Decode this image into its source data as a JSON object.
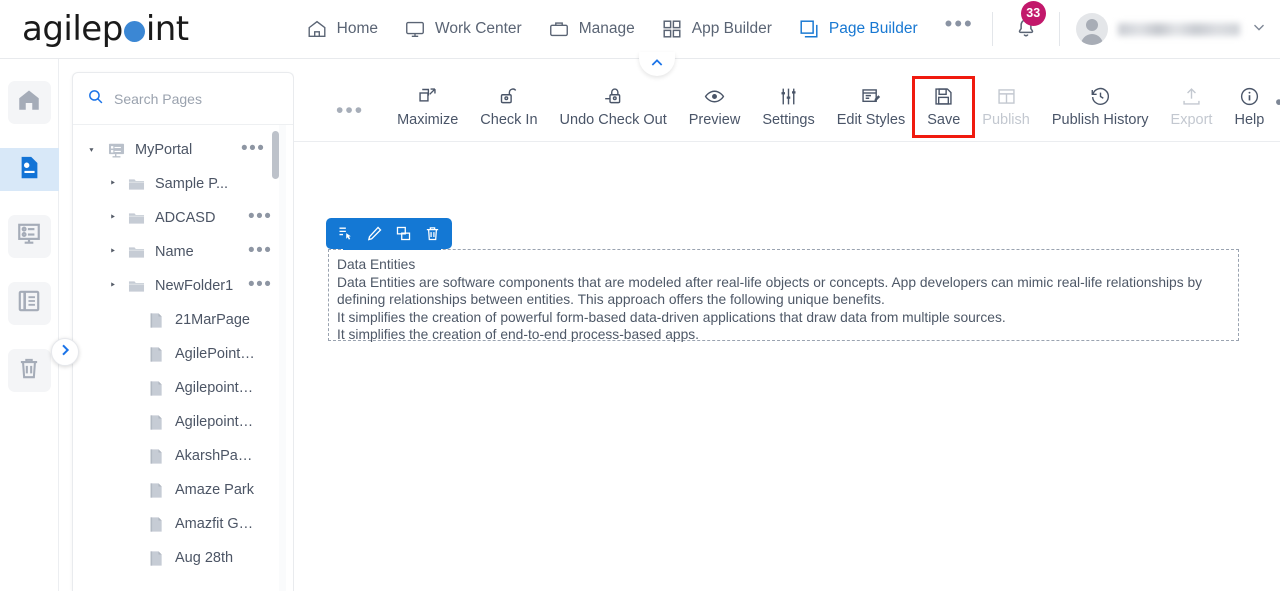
{
  "app": {
    "logo_text_before": "agilep",
    "logo_dot": "o",
    "logo_text_after": "int",
    "brand_blue": "#3b87d4"
  },
  "topnav": {
    "items": [
      {
        "label": "Home",
        "icon": "home-icon",
        "active": false
      },
      {
        "label": "Work Center",
        "icon": "monitor-icon",
        "active": false
      },
      {
        "label": "Manage",
        "icon": "briefcase-icon",
        "active": false
      },
      {
        "label": "App Builder",
        "icon": "grid-icon",
        "active": false
      },
      {
        "label": "Page Builder",
        "icon": "pages-icon",
        "active": true
      }
    ],
    "overflow_label": "•••",
    "notifications": {
      "icon": "bell-icon",
      "count": "33",
      "badge_color": "#c2186b"
    },
    "user": {
      "name_redacted": "",
      "chevron": "chevron-down-icon"
    }
  },
  "rail": {
    "items": [
      {
        "name": "home",
        "icon": "home-icon",
        "active": false
      },
      {
        "name": "pages",
        "icon": "page-document-icon",
        "active": true
      },
      {
        "name": "forms",
        "icon": "form-layout-icon",
        "active": false
      },
      {
        "name": "lists",
        "icon": "list-icon",
        "active": false
      },
      {
        "name": "recycle-bin",
        "icon": "trash-icon",
        "active": false
      }
    ],
    "expand_button": "chevron-right-icon"
  },
  "tree_panel": {
    "search": {
      "placeholder": "Search Pages",
      "value": "",
      "icon": "search-icon"
    },
    "nodes": [
      {
        "label": "MyPortal",
        "icon": "portal-monitor-icon",
        "indent": 0,
        "toggle": "expanded",
        "menu": true,
        "type": "portal"
      },
      {
        "label": "Sample P...",
        "icon": "folder-icon",
        "indent": 1,
        "toggle": "collapsed",
        "menu": false,
        "type": "folder"
      },
      {
        "label": "ADCASD",
        "icon": "folder-icon",
        "indent": 1,
        "toggle": "collapsed",
        "menu": true,
        "type": "folder"
      },
      {
        "label": "Name",
        "icon": "folder-icon",
        "indent": 1,
        "toggle": "collapsed",
        "menu": true,
        "type": "folder"
      },
      {
        "label": "NewFolder1",
        "icon": "folder-icon",
        "indent": 1,
        "toggle": "collapsed",
        "menu": true,
        "type": "folder"
      },
      {
        "label": "21MarPage",
        "icon": "page-icon",
        "indent": 2,
        "toggle": "none",
        "menu": false,
        "type": "page"
      },
      {
        "label": "AgilePoint…",
        "icon": "page-icon",
        "indent": 2,
        "toggle": "none",
        "menu": false,
        "type": "page"
      },
      {
        "label": "Agilepoint…",
        "icon": "page-icon",
        "indent": 2,
        "toggle": "none",
        "menu": false,
        "type": "page"
      },
      {
        "label": "Agilepoint…",
        "icon": "page-icon",
        "indent": 2,
        "toggle": "none",
        "menu": false,
        "type": "page"
      },
      {
        "label": "AkarshPa…",
        "icon": "page-icon",
        "indent": 2,
        "toggle": "none",
        "menu": false,
        "type": "page"
      },
      {
        "label": "Amaze Park",
        "icon": "page-icon",
        "indent": 2,
        "toggle": "none",
        "menu": false,
        "type": "page"
      },
      {
        "label": "Amazfit G…",
        "icon": "page-icon",
        "indent": 2,
        "toggle": "none",
        "menu": false,
        "type": "page"
      },
      {
        "label": "Aug 28th",
        "icon": "page-icon",
        "indent": 2,
        "toggle": "none",
        "menu": false,
        "type": "page"
      }
    ]
  },
  "toolbar": {
    "collapse_chevron": "chevron-up-icon",
    "overflow_left": "•••",
    "items": [
      {
        "label": "Maximize",
        "icon": "maximize-icon",
        "disabled": false,
        "highlighted": false
      },
      {
        "label": "Check In",
        "icon": "unlock-icon",
        "disabled": false,
        "highlighted": false
      },
      {
        "label": "Undo Check Out",
        "icon": "lock-undo-icon",
        "disabled": false,
        "highlighted": false
      },
      {
        "label": "Preview",
        "icon": "eye-icon",
        "disabled": false,
        "highlighted": false
      },
      {
        "label": "Settings",
        "icon": "sliders-icon",
        "disabled": false,
        "highlighted": false
      },
      {
        "label": "Edit Styles",
        "icon": "edit-styles-icon",
        "disabled": false,
        "highlighted": false
      },
      {
        "label": "Save",
        "icon": "save-floppy-icon",
        "disabled": false,
        "highlighted": true
      },
      {
        "label": "Publish",
        "icon": "publish-icon",
        "disabled": true,
        "highlighted": false
      },
      {
        "label": "Publish History",
        "icon": "history-clock-icon",
        "disabled": false,
        "highlighted": false
      },
      {
        "label": "Export",
        "icon": "export-upload-icon",
        "disabled": true,
        "highlighted": false
      },
      {
        "label": "Help",
        "icon": "info-circle-icon",
        "disabled": false,
        "highlighted": false
      }
    ],
    "more": {
      "dots": "•••",
      "chevron": "chevron-down-icon"
    },
    "highlight_color": "#f01a0f"
  },
  "canvas": {
    "element_toolbar": {
      "background": "#1478d4",
      "buttons": [
        {
          "name": "move-select-icon"
        },
        {
          "name": "edit-pencil-icon"
        },
        {
          "name": "duplicate-copy-icon"
        },
        {
          "name": "delete-trash-icon"
        }
      ]
    },
    "content": {
      "lines": [
        "Data Entities",
        "Data Entities are software components that are modeled after real-life objects or concepts. App developers can mimic real-life relationships by defining relationships between entities. This approach offers the following unique benefits.",
        "It simplifies the creation of powerful form-based data-driven applications that draw data from multiple sources.",
        "It simplifies the creation of end-to-end process-based apps."
      ]
    }
  }
}
